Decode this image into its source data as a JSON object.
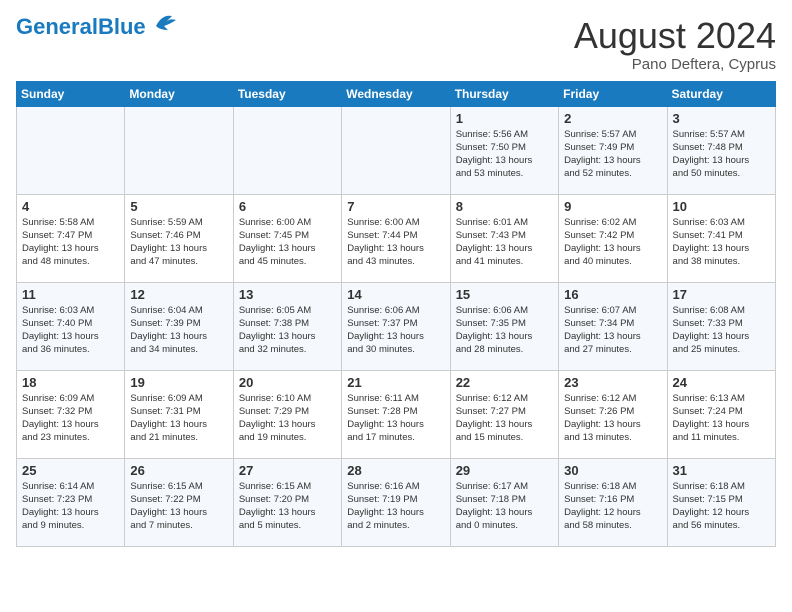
{
  "header": {
    "logo_general": "General",
    "logo_blue": "Blue",
    "month_year": "August 2024",
    "location": "Pano Deftera, Cyprus"
  },
  "days_of_week": [
    "Sunday",
    "Monday",
    "Tuesday",
    "Wednesday",
    "Thursday",
    "Friday",
    "Saturday"
  ],
  "weeks": [
    [
      {
        "num": "",
        "info": ""
      },
      {
        "num": "",
        "info": ""
      },
      {
        "num": "",
        "info": ""
      },
      {
        "num": "",
        "info": ""
      },
      {
        "num": "1",
        "info": "Sunrise: 5:56 AM\nSunset: 7:50 PM\nDaylight: 13 hours\nand 53 minutes."
      },
      {
        "num": "2",
        "info": "Sunrise: 5:57 AM\nSunset: 7:49 PM\nDaylight: 13 hours\nand 52 minutes."
      },
      {
        "num": "3",
        "info": "Sunrise: 5:57 AM\nSunset: 7:48 PM\nDaylight: 13 hours\nand 50 minutes."
      }
    ],
    [
      {
        "num": "4",
        "info": "Sunrise: 5:58 AM\nSunset: 7:47 PM\nDaylight: 13 hours\nand 48 minutes."
      },
      {
        "num": "5",
        "info": "Sunrise: 5:59 AM\nSunset: 7:46 PM\nDaylight: 13 hours\nand 47 minutes."
      },
      {
        "num": "6",
        "info": "Sunrise: 6:00 AM\nSunset: 7:45 PM\nDaylight: 13 hours\nand 45 minutes."
      },
      {
        "num": "7",
        "info": "Sunrise: 6:00 AM\nSunset: 7:44 PM\nDaylight: 13 hours\nand 43 minutes."
      },
      {
        "num": "8",
        "info": "Sunrise: 6:01 AM\nSunset: 7:43 PM\nDaylight: 13 hours\nand 41 minutes."
      },
      {
        "num": "9",
        "info": "Sunrise: 6:02 AM\nSunset: 7:42 PM\nDaylight: 13 hours\nand 40 minutes."
      },
      {
        "num": "10",
        "info": "Sunrise: 6:03 AM\nSunset: 7:41 PM\nDaylight: 13 hours\nand 38 minutes."
      }
    ],
    [
      {
        "num": "11",
        "info": "Sunrise: 6:03 AM\nSunset: 7:40 PM\nDaylight: 13 hours\nand 36 minutes."
      },
      {
        "num": "12",
        "info": "Sunrise: 6:04 AM\nSunset: 7:39 PM\nDaylight: 13 hours\nand 34 minutes."
      },
      {
        "num": "13",
        "info": "Sunrise: 6:05 AM\nSunset: 7:38 PM\nDaylight: 13 hours\nand 32 minutes."
      },
      {
        "num": "14",
        "info": "Sunrise: 6:06 AM\nSunset: 7:37 PM\nDaylight: 13 hours\nand 30 minutes."
      },
      {
        "num": "15",
        "info": "Sunrise: 6:06 AM\nSunset: 7:35 PM\nDaylight: 13 hours\nand 28 minutes."
      },
      {
        "num": "16",
        "info": "Sunrise: 6:07 AM\nSunset: 7:34 PM\nDaylight: 13 hours\nand 27 minutes."
      },
      {
        "num": "17",
        "info": "Sunrise: 6:08 AM\nSunset: 7:33 PM\nDaylight: 13 hours\nand 25 minutes."
      }
    ],
    [
      {
        "num": "18",
        "info": "Sunrise: 6:09 AM\nSunset: 7:32 PM\nDaylight: 13 hours\nand 23 minutes."
      },
      {
        "num": "19",
        "info": "Sunrise: 6:09 AM\nSunset: 7:31 PM\nDaylight: 13 hours\nand 21 minutes."
      },
      {
        "num": "20",
        "info": "Sunrise: 6:10 AM\nSunset: 7:29 PM\nDaylight: 13 hours\nand 19 minutes."
      },
      {
        "num": "21",
        "info": "Sunrise: 6:11 AM\nSunset: 7:28 PM\nDaylight: 13 hours\nand 17 minutes."
      },
      {
        "num": "22",
        "info": "Sunrise: 6:12 AM\nSunset: 7:27 PM\nDaylight: 13 hours\nand 15 minutes."
      },
      {
        "num": "23",
        "info": "Sunrise: 6:12 AM\nSunset: 7:26 PM\nDaylight: 13 hours\nand 13 minutes."
      },
      {
        "num": "24",
        "info": "Sunrise: 6:13 AM\nSunset: 7:24 PM\nDaylight: 13 hours\nand 11 minutes."
      }
    ],
    [
      {
        "num": "25",
        "info": "Sunrise: 6:14 AM\nSunset: 7:23 PM\nDaylight: 13 hours\nand 9 minutes."
      },
      {
        "num": "26",
        "info": "Sunrise: 6:15 AM\nSunset: 7:22 PM\nDaylight: 13 hours\nand 7 minutes."
      },
      {
        "num": "27",
        "info": "Sunrise: 6:15 AM\nSunset: 7:20 PM\nDaylight: 13 hours\nand 5 minutes."
      },
      {
        "num": "28",
        "info": "Sunrise: 6:16 AM\nSunset: 7:19 PM\nDaylight: 13 hours\nand 2 minutes."
      },
      {
        "num": "29",
        "info": "Sunrise: 6:17 AM\nSunset: 7:18 PM\nDaylight: 13 hours\nand 0 minutes."
      },
      {
        "num": "30",
        "info": "Sunrise: 6:18 AM\nSunset: 7:16 PM\nDaylight: 12 hours\nand 58 minutes."
      },
      {
        "num": "31",
        "info": "Sunrise: 6:18 AM\nSunset: 7:15 PM\nDaylight: 12 hours\nand 56 minutes."
      }
    ]
  ]
}
